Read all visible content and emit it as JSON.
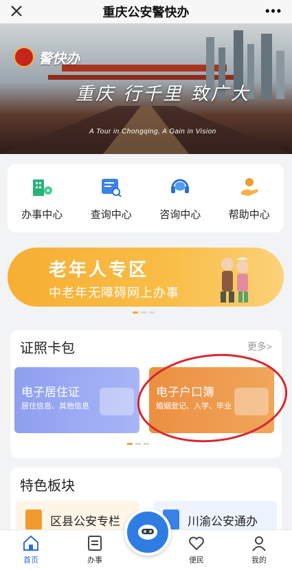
{
  "topbar": {
    "title": "重庆公安警快办",
    "more": "•••"
  },
  "banner": {
    "logo_text": "警快办",
    "slogan": "重庆 行千里 致广大",
    "slogan_en": "A Tour in Chongqing, A Gain in Vision"
  },
  "quick_menu": [
    {
      "label": "办事中心",
      "icon": "building-pin-icon"
    },
    {
      "label": "查询中心",
      "icon": "search-doc-icon"
    },
    {
      "label": "咨询中心",
      "icon": "headset-icon"
    },
    {
      "label": "帮助中心",
      "icon": "helping-hand-icon"
    }
  ],
  "elder_banner": {
    "title": "老年人专区",
    "subtitle": "中老年无障碍网上办事"
  },
  "cards_section": {
    "title": "证照卡包",
    "more": "更多>",
    "cards": [
      {
        "title": "电子居住证",
        "subtitle": "居住信息、其他信息"
      },
      {
        "title": "电子户口簿",
        "subtitle": "婚姻登记、入学、毕业"
      }
    ]
  },
  "features_section": {
    "title": "特色板块",
    "items": [
      {
        "label": "区县公安专栏"
      },
      {
        "label": "川渝公安通办"
      }
    ]
  },
  "bottom_nav": [
    {
      "label": "首页",
      "icon": "home-icon",
      "active": true
    },
    {
      "label": "办事",
      "icon": "document-icon",
      "active": false
    },
    {
      "label": "便民",
      "icon": "heart-icon",
      "active": false
    },
    {
      "label": "我的",
      "icon": "user-icon",
      "active": false
    }
  ],
  "colors": {
    "accent_blue": "#2b6fd6",
    "elder_orange": "#f7ae33",
    "annotation_red": "#d9262e"
  }
}
